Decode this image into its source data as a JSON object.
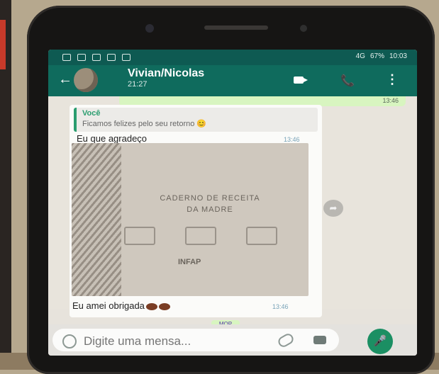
{
  "status": {
    "signal": "4G",
    "battery": "67%",
    "clock": "10:03"
  },
  "header": {
    "back_icon": "arrow-left-icon",
    "name": "Vivian/Nicolas",
    "time": "21:27"
  },
  "chat": {
    "quote_author": "Você",
    "quote_text": "Ficamos felizes pelo seu retorno 😊",
    "message1": "Eu que agradeço",
    "message1_time": "13:46",
    "photo_line1": "CADERNO DE RECEITA",
    "photo_line2": "DA MADRE",
    "photo_brand": "INFAP",
    "message2": "Eu amei obrigada",
    "message2_time": "13:46",
    "outgoing_hint": "MOP"
  },
  "input": {
    "placeholder": "Digite uma mensa..."
  },
  "icons": [
    "emoji-icon",
    "attach-icon",
    "camera-icon",
    "mic-icon",
    "video-call-icon",
    "phone-call-icon",
    "menu-icon",
    "share-icon"
  ],
  "colors": {
    "header": "#0f6b5d",
    "mic": "#1b8f63",
    "outgoing_bubble": "#d8f5c0"
  }
}
